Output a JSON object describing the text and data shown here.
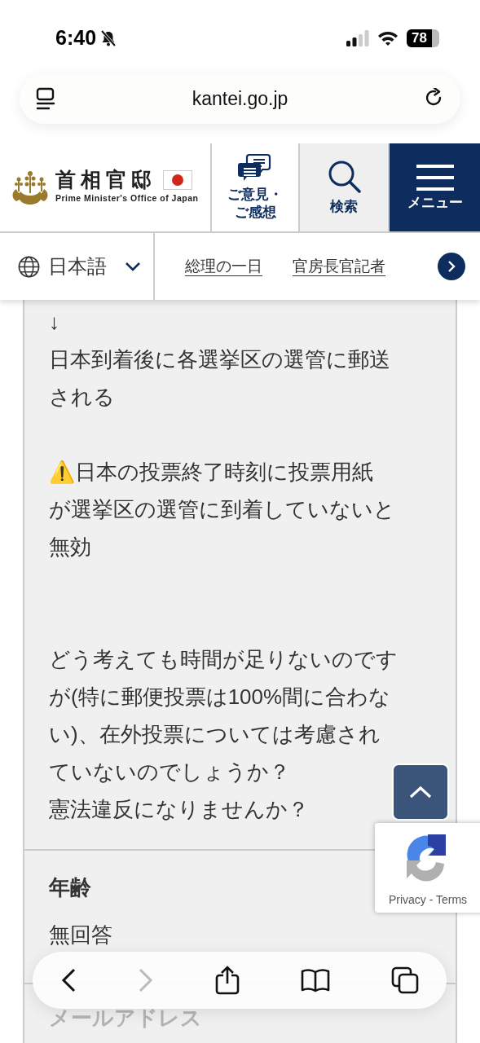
{
  "status_bar": {
    "time": "6:40",
    "battery": "78"
  },
  "address_bar": {
    "url": "kantei.go.jp"
  },
  "header": {
    "logo_title": "首相官邸",
    "logo_subtitle": "Prime Minister's Office of Japan",
    "buttons": [
      {
        "kind": "feedback",
        "label_lines": [
          "ご意見・",
          "ご感想"
        ]
      },
      {
        "kind": "search",
        "label_lines": [
          "検索"
        ]
      },
      {
        "kind": "menu",
        "label_lines": [
          "メニュー"
        ]
      }
    ]
  },
  "nav": {
    "language": "日本語",
    "links": [
      "総理の一日",
      "官房長官記者"
    ]
  },
  "content": {
    "paragraphs": [
      {
        "lines": [
          "↓",
          "日本到着後に各選挙区の選管に郵送",
          "される"
        ]
      },
      {
        "lines": [
          "⚠️日本の投票終了時刻に投票用紙",
          "が選挙区の選管に到着していないと",
          "無効"
        ]
      },
      {
        "lines": [
          "どう考えても時間が足りないのです",
          "が(特に郵便投票は100%間に合わな",
          "い)、在外投票については考慮され",
          "ていないのでしょうか？",
          "憲法違反になりませんか？"
        ]
      }
    ],
    "fields": [
      {
        "label": "年齢",
        "value": "無回答"
      },
      {
        "label": "メールアドレス"
      }
    ]
  },
  "recaptcha": {
    "links": "Privacy - Terms"
  }
}
